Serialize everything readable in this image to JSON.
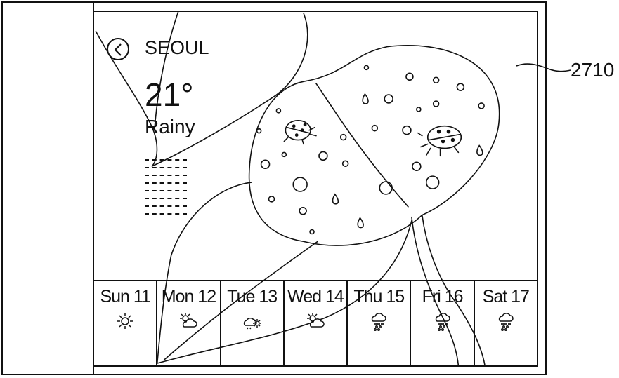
{
  "weather": {
    "city": "SEOUL",
    "temperature": "21°",
    "condition": "Rainy",
    "dash_rows": 8
  },
  "forecast": [
    {
      "label": "Sun 11",
      "icon": "sun-icon"
    },
    {
      "label": "Mon 12",
      "icon": "partly-cloudy-icon"
    },
    {
      "label": "Tue 13",
      "icon": "cloud-sun-icon"
    },
    {
      "label": "Wed 14",
      "icon": "partly-cloudy-icon"
    },
    {
      "label": "Thu 15",
      "icon": "rain-icon"
    },
    {
      "label": "Fri 16",
      "icon": "rain-icon"
    },
    {
      "label": "Sat 17",
      "icon": "rain-icon"
    }
  ],
  "annotation": {
    "reference": "2710"
  }
}
